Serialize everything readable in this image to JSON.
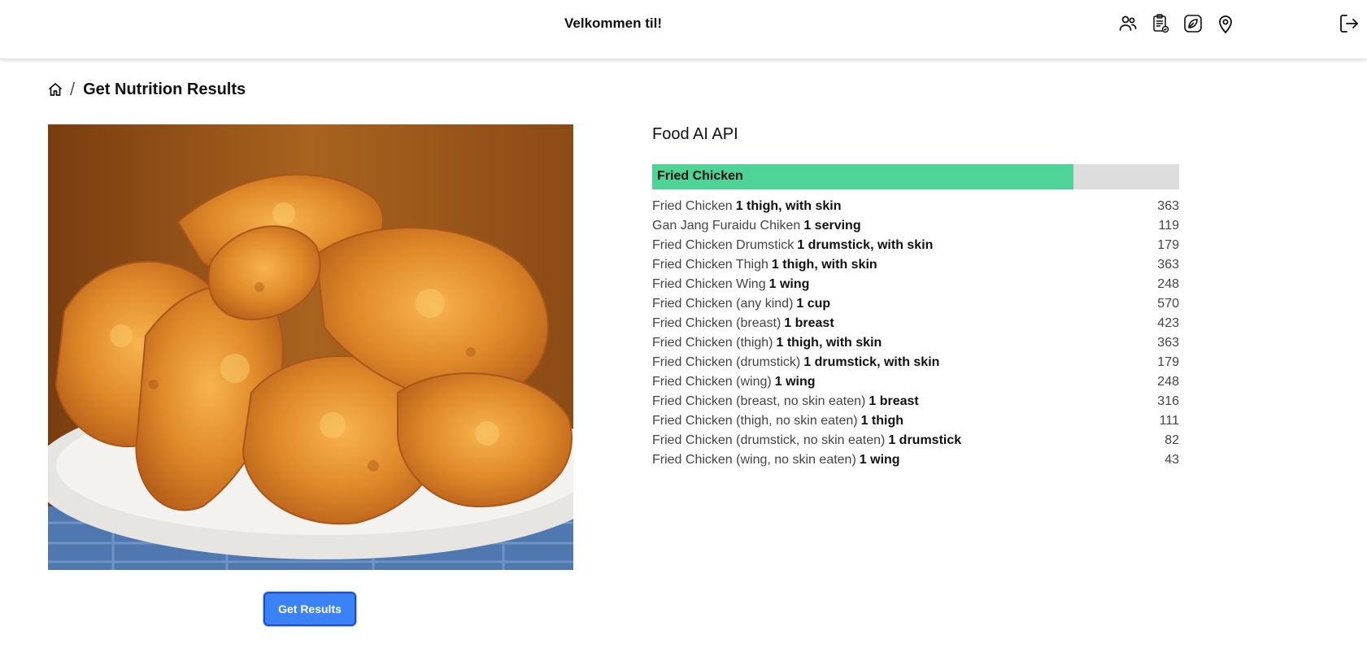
{
  "header": {
    "welcome": "Velkommen til!",
    "icons": [
      "users-icon",
      "clipboard-check-icon",
      "leaf-icon",
      "location-pin-icon"
    ],
    "logout_icon": "logout-icon"
  },
  "breadcrumb": {
    "home_icon": "home-icon",
    "separator": "/",
    "title": "Get Nutrition Results"
  },
  "image": {
    "subject": "fried chicken on a plate"
  },
  "actions": {
    "get_results_label": "Get Results"
  },
  "colors": {
    "primary": "#3b82f6",
    "confidence_fill": "#4fd497",
    "confidence_track": "#dddddd"
  },
  "results": {
    "title": "Food AI API",
    "top_match": {
      "label": "Fried Chicken",
      "confidence": 0.8
    },
    "items": [
      {
        "name": "Fried Chicken",
        "serving": "1 thigh, with skin",
        "calories": "363"
      },
      {
        "name": "Gan Jang Furaidu Chiken",
        "serving": "1 serving",
        "calories": "119"
      },
      {
        "name": "Fried Chicken Drumstick",
        "serving": "1 drumstick, with skin",
        "calories": "179"
      },
      {
        "name": "Fried Chicken Thigh",
        "serving": "1 thigh, with skin",
        "calories": "363"
      },
      {
        "name": "Fried Chicken Wing",
        "serving": "1 wing",
        "calories": "248"
      },
      {
        "name": "Fried Chicken (any kind)",
        "serving": "1 cup",
        "calories": "570"
      },
      {
        "name": "Fried Chicken (breast)",
        "serving": "1 breast",
        "calories": "423"
      },
      {
        "name": "Fried Chicken (thigh)",
        "serving": "1 thigh, with skin",
        "calories": "363"
      },
      {
        "name": "Fried Chicken (drumstick)",
        "serving": "1 drumstick, with skin",
        "calories": "179"
      },
      {
        "name": "Fried Chicken (wing)",
        "serving": "1 wing",
        "calories": "248"
      },
      {
        "name": "Fried Chicken (breast, no skin eaten)",
        "serving": "1 breast",
        "calories": "316"
      },
      {
        "name": "Fried Chicken (thigh, no skin eaten)",
        "serving": "1 thigh",
        "calories": "111"
      },
      {
        "name": "Fried Chicken (drumstick, no skin eaten)",
        "serving": "1 drumstick",
        "calories": "82"
      },
      {
        "name": "Fried Chicken (wing, no skin eaten)",
        "serving": "1 wing",
        "calories": "43"
      }
    ]
  }
}
